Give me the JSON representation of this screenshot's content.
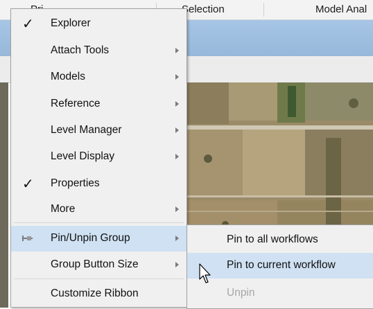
{
  "ribbon_tabs": [
    {
      "label": "Pri"
    },
    {
      "label": "Selection"
    },
    {
      "label": "Model Anal"
    }
  ],
  "context_menu": {
    "items": [
      {
        "label": "Explorer",
        "checked": true,
        "submenu": false,
        "icon": "check-icon"
      },
      {
        "label": "Attach Tools",
        "checked": false,
        "submenu": true
      },
      {
        "label": "Models",
        "checked": false,
        "submenu": true
      },
      {
        "label": "Reference",
        "checked": false,
        "submenu": true
      },
      {
        "label": "Level Manager",
        "checked": false,
        "submenu": true
      },
      {
        "label": "Level Display",
        "checked": false,
        "submenu": true
      },
      {
        "label": "Properties",
        "checked": true,
        "submenu": false,
        "icon": "check-icon"
      },
      {
        "label": "More",
        "checked": false,
        "submenu": true
      },
      {
        "label": "Pin/Unpin Group",
        "checked": false,
        "submenu": true,
        "highlighted": true,
        "icon": "pin-icon"
      },
      {
        "label": "Group Button Size",
        "checked": false,
        "submenu": true
      },
      {
        "label": "Customize Ribbon",
        "checked": false,
        "submenu": false
      }
    ],
    "check_mark": "✓"
  },
  "submenu": {
    "items": [
      {
        "label": "Pin to all workflows",
        "enabled": true
      },
      {
        "label": "Pin to current workflow",
        "enabled": true,
        "highlighted": true
      },
      {
        "label": "Unpin",
        "enabled": false
      }
    ]
  },
  "colors": {
    "menu_bg": "#f0f0f0",
    "highlight": "#cfe1f3",
    "disabled_text": "#a6a6a6"
  }
}
